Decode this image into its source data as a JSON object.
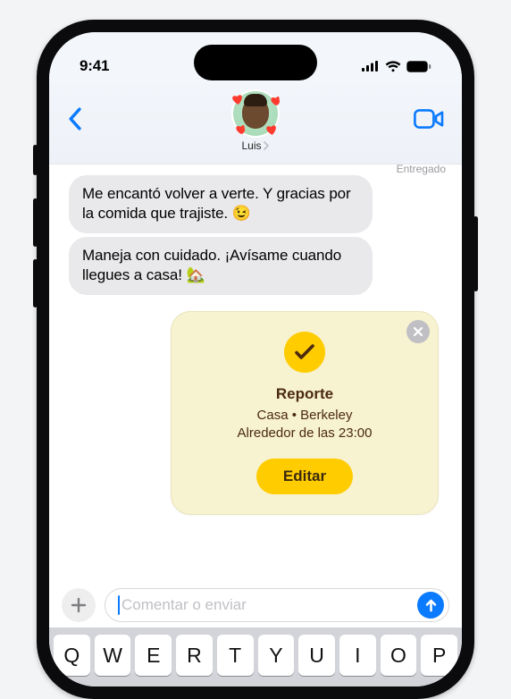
{
  "status": {
    "time": "9:41"
  },
  "nav": {
    "contact_name": "Luis"
  },
  "thread": {
    "delivered_label": "Entregado",
    "bubbles": [
      "Me encantó volver a verte. Y gracias por la comida que trajiste. 😉",
      "Maneja con cuidado. ¡Avísame cuando llegues a casa! 🏡"
    ]
  },
  "checkin": {
    "title": "Reporte",
    "line1": "Casa • Berkeley",
    "line2": "Alrededor de las 23:00",
    "edit": "Editar"
  },
  "compose": {
    "placeholder": "Comentar o enviar"
  },
  "keyboard": {
    "row1": [
      "Q",
      "W",
      "E",
      "R",
      "T",
      "Y",
      "U",
      "I",
      "O",
      "P"
    ]
  }
}
